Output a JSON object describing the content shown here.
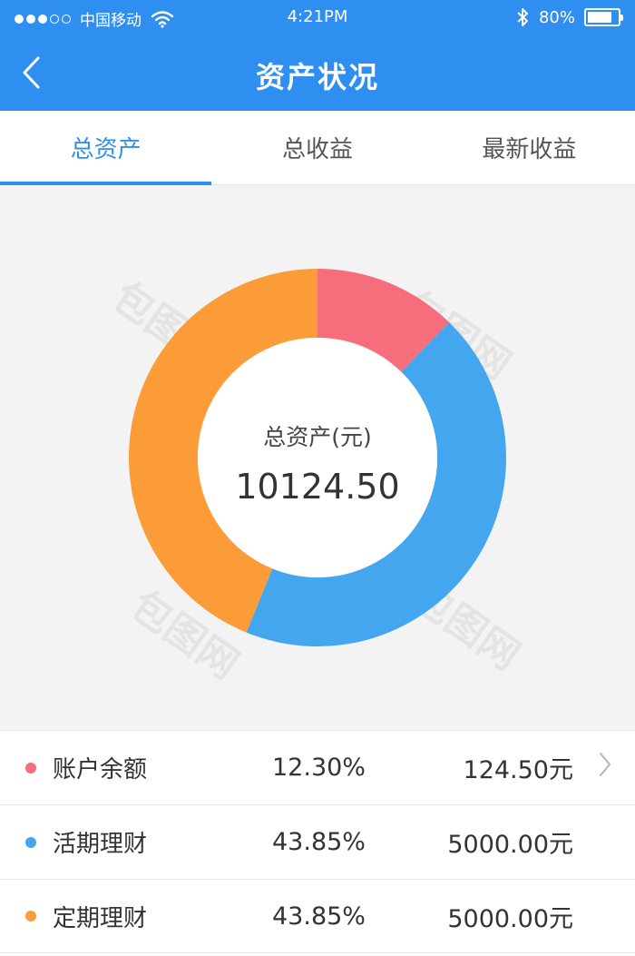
{
  "status_bar": {
    "carrier": "中国移动",
    "time": "4:21PM",
    "battery": "80%",
    "battery_level": 0.8,
    "icons": [
      "signal-dots-icon",
      "wifi-icon",
      "bluetooth-icon",
      "battery-icon"
    ]
  },
  "nav": {
    "title": "资产状况",
    "back_icon": "chevron-left-icon"
  },
  "tabs": [
    {
      "label": "总资产",
      "active": true
    },
    {
      "label": "总收益",
      "active": false
    },
    {
      "label": "最新收益",
      "active": false
    }
  ],
  "chart": {
    "center_label": "总资产(元)",
    "center_value": "10124.50",
    "watermark": "包图网"
  },
  "chart_data": {
    "type": "pie",
    "categories": [
      "账户余额",
      "活期理财",
      "定期理财"
    ],
    "values": [
      12.3,
      43.85,
      43.85
    ],
    "colors": [
      "#f66d7c",
      "#45a6f0",
      "#fb9c38"
    ]
  },
  "items": [
    {
      "name": "账户余额",
      "percent": "12.30%",
      "amount": "124.50元",
      "color": "#f66d7c",
      "has_chevron": true
    },
    {
      "name": "活期理财",
      "percent": "43.85%",
      "amount": "5000.00元",
      "color": "#45a6f0",
      "has_chevron": false
    },
    {
      "name": "定期理财",
      "percent": "43.85%",
      "amount": "5000.00元",
      "color": "#fb9c38",
      "has_chevron": false
    }
  ]
}
